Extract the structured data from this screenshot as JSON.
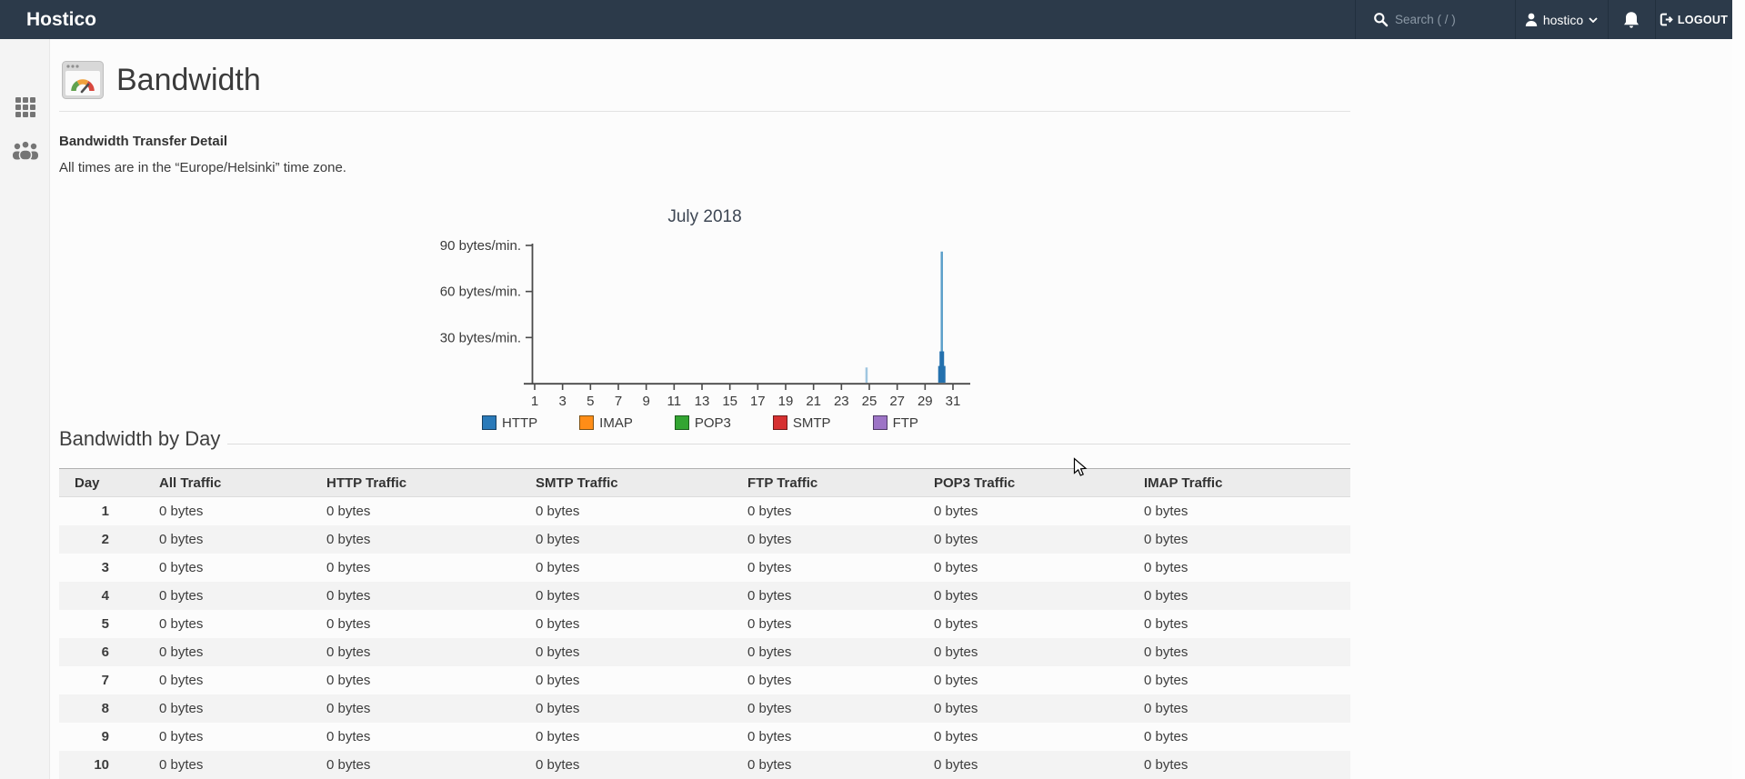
{
  "navbar": {
    "brand": "Hostico",
    "search_placeholder": "Search ( / )",
    "username": "hostico",
    "logout_label": "LOGOUT"
  },
  "sidebar": {
    "items": [
      {
        "icon": "apps-grid"
      },
      {
        "icon": "user-groups"
      }
    ]
  },
  "page": {
    "title": "Bandwidth",
    "detail_heading": "Bandwidth Transfer Detail",
    "timezone_note": "All times are in the “Europe/Helsinki” time zone.",
    "byday_heading": "Bandwidth by Day"
  },
  "chart_data": {
    "type": "bar",
    "title": "July 2018",
    "xlabel": "",
    "ylabel": "bytes/min.",
    "x_axis": {
      "range": [
        1,
        31
      ],
      "ticks": [
        1,
        3,
        5,
        7,
        9,
        11,
        13,
        15,
        17,
        19,
        21,
        23,
        25,
        27,
        29,
        31
      ]
    },
    "y_axis": {
      "range": [
        0,
        95
      ],
      "unit": "bytes/min.",
      "ticks": [
        {
          "value": 90,
          "label": "90 bytes/min."
        },
        {
          "value": 60,
          "label": "60 bytes/min."
        },
        {
          "value": 30,
          "label": "30 bytes/min."
        }
      ]
    },
    "bars": [
      {
        "day": 24.8,
        "value": 10.5,
        "series": "HTTP peak",
        "color": "#9fc6e0",
        "width": 2.5
      },
      {
        "day": 30.2,
        "value": 86,
        "series": "HTTP peak",
        "color": "#5b9fca",
        "width": 2.5
      },
      {
        "day": 30.2,
        "value": 21,
        "series": "HTTP",
        "color": "#2471ae",
        "width": 5
      },
      {
        "day": 30.2,
        "value": 11.5,
        "series": "HTTP",
        "color": "#2471ae",
        "width": 8
      }
    ],
    "legend": [
      {
        "label": "HTTP",
        "color": "#2a7ab9",
        "border": "#173f60"
      },
      {
        "label": "IMAP",
        "color": "#ff8d17",
        "border": "#7d5215"
      },
      {
        "label": "POP3",
        "color": "#33a532",
        "border": "#1d5c1d"
      },
      {
        "label": "SMTP",
        "color": "#d63031",
        "border": "#6e1b1b"
      },
      {
        "label": "FTP",
        "color": "#9d74c6",
        "border": "#4f3a66"
      }
    ],
    "legend_position": "bottom",
    "grid": false
  },
  "table": {
    "headers": [
      "Day",
      "All Traffic",
      "HTTP Traffic",
      "SMTP Traffic",
      "FTP Traffic",
      "POP3 Traffic",
      "IMAP Traffic"
    ],
    "rows": [
      {
        "day": "1",
        "values": [
          "0 bytes",
          "0 bytes",
          "0 bytes",
          "0 bytes",
          "0 bytes",
          "0 bytes"
        ]
      },
      {
        "day": "2",
        "values": [
          "0 bytes",
          "0 bytes",
          "0 bytes",
          "0 bytes",
          "0 bytes",
          "0 bytes"
        ]
      },
      {
        "day": "3",
        "values": [
          "0 bytes",
          "0 bytes",
          "0 bytes",
          "0 bytes",
          "0 bytes",
          "0 bytes"
        ]
      },
      {
        "day": "4",
        "values": [
          "0 bytes",
          "0 bytes",
          "0 bytes",
          "0 bytes",
          "0 bytes",
          "0 bytes"
        ]
      },
      {
        "day": "5",
        "values": [
          "0 bytes",
          "0 bytes",
          "0 bytes",
          "0 bytes",
          "0 bytes",
          "0 bytes"
        ]
      },
      {
        "day": "6",
        "values": [
          "0 bytes",
          "0 bytes",
          "0 bytes",
          "0 bytes",
          "0 bytes",
          "0 bytes"
        ]
      },
      {
        "day": "7",
        "values": [
          "0 bytes",
          "0 bytes",
          "0 bytes",
          "0 bytes",
          "0 bytes",
          "0 bytes"
        ]
      },
      {
        "day": "8",
        "values": [
          "0 bytes",
          "0 bytes",
          "0 bytes",
          "0 bytes",
          "0 bytes",
          "0 bytes"
        ]
      },
      {
        "day": "9",
        "values": [
          "0 bytes",
          "0 bytes",
          "0 bytes",
          "0 bytes",
          "0 bytes",
          "0 bytes"
        ]
      },
      {
        "day": "10",
        "values": [
          "0 bytes",
          "0 bytes",
          "0 bytes",
          "0 bytes",
          "0 bytes",
          "0 bytes"
        ]
      }
    ]
  }
}
